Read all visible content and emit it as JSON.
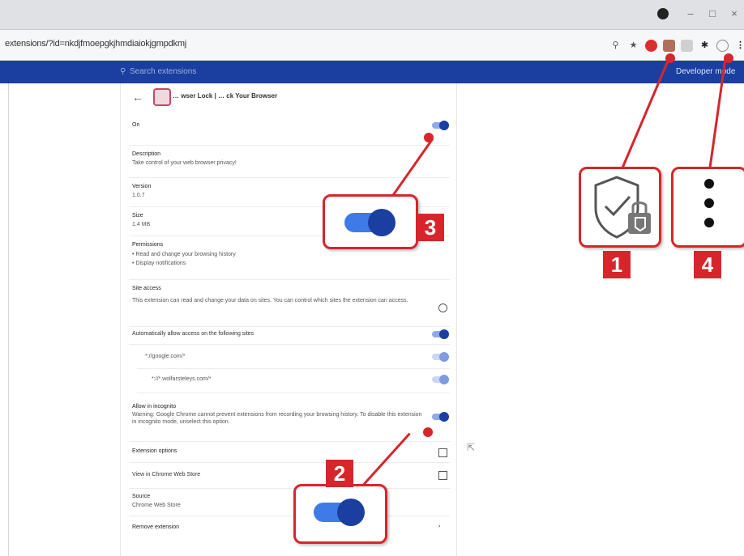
{
  "titlebar": {
    "controls": [
      "–",
      "□",
      "×"
    ]
  },
  "address_bar": {
    "url": "extensions/?id=nkdjfmoepgkjhmdiaiokjgmpdkmj"
  },
  "toolbar_icons": [
    "search-icon",
    "star-icon",
    "extension-red-icon",
    "shield-lock-icon",
    "puzzle-grey-icon",
    "pin-icon",
    "profile-icon",
    "menu-icon"
  ],
  "header": {
    "search_placeholder": "Search extensions",
    "developer_mode": "Developer mode"
  },
  "details": {
    "name": "… wser Lock | … ck Your Browser",
    "on_label": "On",
    "description_label": "Description",
    "description": "Take control of your web browser privacy!",
    "version_label": "Version",
    "version": "1.0.7",
    "size_label": "Size",
    "size": "1.4 MB",
    "permissions_label": "Permissions",
    "permissions": [
      "Read and change your browsing history",
      "Display notifications"
    ],
    "site_access_label": "Site access",
    "site_access_text": "This extension can read and change your data on sites. You can control which sites the extension can access.",
    "auto_allow_label": "Automatically allow access on the following sites",
    "sites": [
      "*://google.com/*",
      "*://*.wolfarsteleys.com/*"
    ],
    "incognito_label": "Allow in incognito",
    "incognito_warning": "Warning: Google Chrome cannot prevent extensions from recording your browsing history. To disable this extension in incognito mode, unselect this option.",
    "ext_options": "Extension options",
    "view_store": "View in Chrome Web Store",
    "source_label": "Source",
    "source": "Chrome Web Store",
    "remove": "Remove extension"
  },
  "callouts": {
    "n1": "1",
    "n2": "2",
    "n3": "3",
    "n4": "4"
  },
  "colors": {
    "accent_red": "#d6262b",
    "header_blue": "#1a3fa0"
  }
}
